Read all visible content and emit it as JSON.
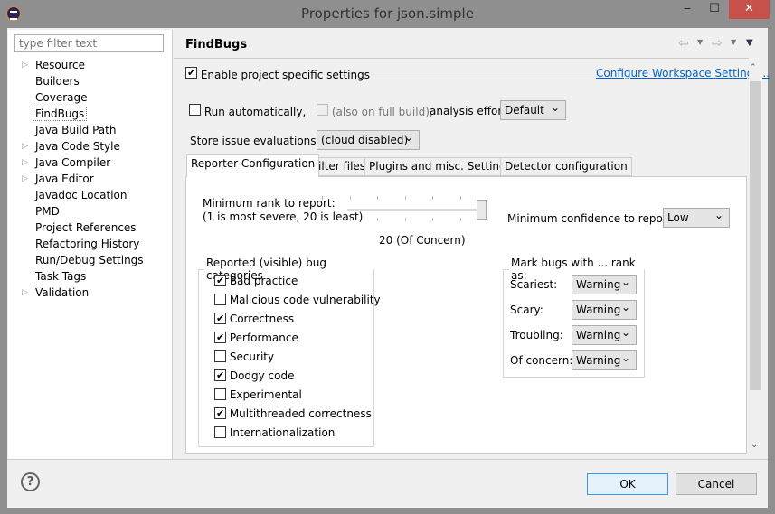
{
  "window": {
    "title": "Properties for json.simple",
    "minimize": "‒",
    "maximize": "☐",
    "close": "✕"
  },
  "sidebar": {
    "filter_placeholder": "type filter text",
    "items": [
      {
        "label": "Resource",
        "expandable": true
      },
      {
        "label": "Builders",
        "expandable": false
      },
      {
        "label": "Coverage",
        "expandable": false
      },
      {
        "label": "FindBugs",
        "expandable": false,
        "selected": true
      },
      {
        "label": "Java Build Path",
        "expandable": false
      },
      {
        "label": "Java Code Style",
        "expandable": true
      },
      {
        "label": "Java Compiler",
        "expandable": true
      },
      {
        "label": "Java Editor",
        "expandable": true
      },
      {
        "label": "Javadoc Location",
        "expandable": false
      },
      {
        "label": "PMD",
        "expandable": false
      },
      {
        "label": "Project References",
        "expandable": false
      },
      {
        "label": "Refactoring History",
        "expandable": false
      },
      {
        "label": "Run/Debug Settings",
        "expandable": false
      },
      {
        "label": "Task Tags",
        "expandable": false
      },
      {
        "label": "Validation",
        "expandable": true
      }
    ]
  },
  "page": {
    "title": "FindBugs",
    "enable_label": "Enable project specific settings",
    "enable_checked": true,
    "configure_link": "Configure Workspace Settings...",
    "run_auto_label": "Run automatically,",
    "run_auto_checked": false,
    "full_build_label": "(also on full build),",
    "full_build_checked": false,
    "effort_label": "analysis effort",
    "effort_value": "Default",
    "store_label": "Store issue evaluations in:",
    "store_value": "(cloud disabled)"
  },
  "tabs": [
    {
      "label": "Reporter Configuration",
      "active": true
    },
    {
      "label": "Filter files"
    },
    {
      "label": "Plugins and misc. Settings"
    },
    {
      "label": "Detector configuration"
    }
  ],
  "reporter": {
    "rank_label1": "Minimum rank to report:",
    "rank_label2": "(1 is most severe, 20 is least)",
    "rank_value": 20,
    "rank_min": 1,
    "rank_max": 20,
    "rank_text": "20 (Of Concern)",
    "confidence_label": "Minimum confidence to report:",
    "confidence_value": "Low",
    "categories_title": "Reported (visible) bug categories",
    "categories": [
      {
        "label": "Bad practice",
        "checked": true
      },
      {
        "label": "Malicious code vulnerability",
        "checked": false
      },
      {
        "label": "Correctness",
        "checked": true
      },
      {
        "label": "Performance",
        "checked": true
      },
      {
        "label": "Security",
        "checked": false
      },
      {
        "label": "Dodgy code",
        "checked": true
      },
      {
        "label": "Experimental",
        "checked": false
      },
      {
        "label": "Multithreaded correctness",
        "checked": true
      },
      {
        "label": "Internationalization",
        "checked": false
      }
    ],
    "mark_title": "Mark bugs with ... rank as:",
    "marks": [
      {
        "label": "Scariest:",
        "value": "Warning"
      },
      {
        "label": "Scary:",
        "value": "Warning"
      },
      {
        "label": "Troubling:",
        "value": "Warning"
      },
      {
        "label": "Of concern:",
        "value": "Warning"
      }
    ]
  },
  "buttons": {
    "ok": "OK",
    "cancel": "Cancel",
    "help": "?"
  },
  "colors": {
    "link": "#0066cc",
    "close_button": "#c7504a",
    "ok_border": "#3399ff"
  }
}
